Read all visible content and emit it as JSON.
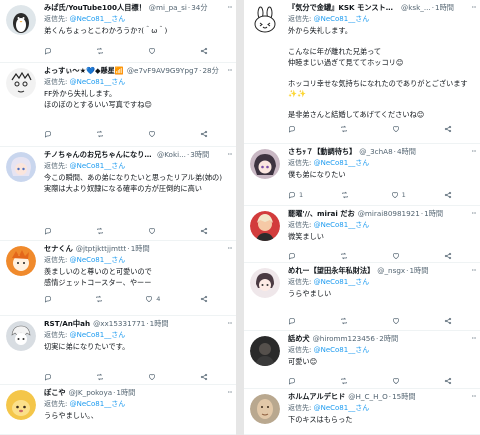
{
  "reply_prefix": "返信先:",
  "left": [
    {
      "name": "みぱ氏/YouTube100人目標！",
      "handle": "@mi_pa_si",
      "time": "34分",
      "reply_to": "@NeCo81__さん",
      "text": [
        "弟くんちょっとこわかろうか?(＾ω＾)"
      ],
      "stats": [
        "",
        "",
        ""
      ],
      "avatar": {
        "icon": "penguin-avatar",
        "bg": "#dfe6ea"
      }
    },
    {
      "name": "よっすぃ～★💙◆懸星📶",
      "handle": "@e7vF9AV9G9Ypg7",
      "time": "28分",
      "reply_to": "@NeCo81__さん",
      "text": [
        "FF外から失礼します。",
        "ほのぼのとするいい写真ですね😊"
      ],
      "stats": [
        "",
        "",
        ""
      ],
      "avatar": {
        "icon": "anime-line-avatar",
        "bg": "#f2f2f2"
      }
    },
    {
      "name": "チノちゃんのお兄ちゃんになりたい人",
      "handle": "@Koki...",
      "time": "3時間",
      "reply_to": "@NeCo81__さん",
      "text": [
        "今この瞬間、あの弟になりたいと思ったリアル弟(姉の)",
        "実際は大より奴隷になる確率の方が圧倒的に高い"
      ],
      "stats": [
        "",
        "",
        ""
      ],
      "avatar": {
        "icon": "anime-girl-avatar",
        "bg": "#c9d6ee"
      }
    },
    {
      "name": "セナくん",
      "handle": "@jtptjkttjjmttt",
      "time": "1時間",
      "reply_to": "@NeCo81__さん",
      "text": [
        "羨ましいのと尊いのと可愛いので",
        "感情ジェットコースター、やーー"
      ],
      "stats": [
        "",
        "",
        "4"
      ],
      "avatar": {
        "icon": "orange-character-avatar",
        "bg": "#f08a2c"
      }
    },
    {
      "name": "RST/An中ah",
      "handle": "@xx15331771",
      "time": "1時間",
      "reply_to": "@NeCo81__さん",
      "text": [
        "切実に弟になりたいです。"
      ],
      "stats": [
        "",
        "",
        ""
      ],
      "avatar": {
        "icon": "anime-boy-avatar",
        "bg": "#d8dde2"
      }
    },
    {
      "name": "ぽこや",
      "handle": "@JK_pokoya",
      "time": "1時間",
      "reply_to": "@NeCo81__さん",
      "text": [
        "うらやましい。、"
      ],
      "stats": [],
      "avatar": {
        "icon": "yellow-character-avatar",
        "bg": "#f4c64a"
      }
    }
  ],
  "right": [
    {
      "name": "『気分で金罐』KSK モンスト&趣味垢",
      "handle": "@ksk_...",
      "time": "1時間",
      "reply_to": "@NeCo81__さん",
      "text": [
        "外から失礼します。",
        "",
        "こんなに年が離れた兄弟って",
        "仲睦まじい過ぎて見ててホッコリ😊",
        "",
        "ホッコリ幸せな気持ちになれたのでありがとございます✨✨",
        "",
        "是非弟さんと結婚してあげてくださいね😊"
      ],
      "stats": [
        "",
        "",
        ""
      ],
      "avatar": {
        "icon": "rabbit-avatar",
        "bg": "#ffffff"
      }
    },
    {
      "name": "さちｯ７【動調待ち】",
      "handle": "@_3chA8",
      "time": "4時間",
      "reply_to": "@NeCo81__さん",
      "text": [
        "僕も弟になりたい"
      ],
      "stats": [
        "1",
        "",
        "1"
      ],
      "avatar": {
        "icon": "anime-face-avatar",
        "bg": "#c9b8c4"
      }
    },
    {
      "name": "罷曜'//、mirai だお",
      "handle": "@mirai80981921",
      "time": "1時間",
      "reply_to": "@NeCo81__さん",
      "text": [
        "微笑ましい"
      ],
      "stats": [
        "",
        "",
        ""
      ],
      "avatar": {
        "icon": "red-portrait-avatar",
        "bg": "#d23c3c"
      }
    },
    {
      "name": "めれー【望田永年私財法】",
      "handle": "@_nsgx",
      "time": "1時間",
      "reply_to": "@NeCo81__さん",
      "text": [
        "うらやましい"
      ],
      "stats": [
        "",
        "",
        ""
      ],
      "avatar": {
        "icon": "chibi-avatar",
        "bg": "#efe7ea"
      }
    },
    {
      "name": "話め犬",
      "handle": "@hiromm123456",
      "time": "2時間",
      "reply_to": "@NeCo81__さん",
      "text": [
        "可愛い😊"
      ],
      "stats": [
        "",
        "",
        ""
      ],
      "avatar": {
        "icon": "dark-photo-avatar",
        "bg": "#2a2a2a"
      }
    },
    {
      "name": "ホルムアルデヒド",
      "handle": "@H_C_H_O",
      "time": "15時間",
      "reply_to": "@NeCo81__さん",
      "text": [
        "下のキスはもらった"
      ],
      "stats": [],
      "avatar": {
        "icon": "photo-face-avatar",
        "bg": "#b9a88f"
      }
    }
  ]
}
